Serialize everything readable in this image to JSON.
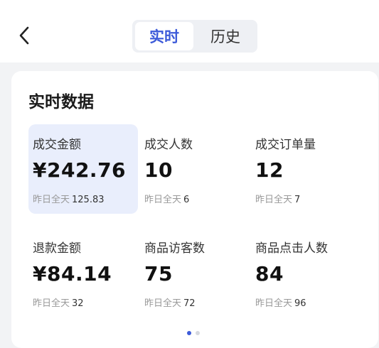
{
  "nav": {
    "back_icon": "chevron-left-icon",
    "tabs": [
      {
        "label": "实时",
        "active": true
      },
      {
        "label": "历史",
        "active": false
      }
    ]
  },
  "card": {
    "title": "实时数据",
    "metrics": [
      {
        "label": "成交金额",
        "value": "¥242.76",
        "sub_label": "昨日全天",
        "sub_value": "125.83",
        "highlighted": true
      },
      {
        "label": "成交人数",
        "value": "10",
        "sub_label": "昨日全天",
        "sub_value": "6",
        "highlighted": false
      },
      {
        "label": "成交订单量",
        "value": "12",
        "sub_label": "昨日全天",
        "sub_value": "7",
        "highlighted": false
      },
      {
        "label": "退款金额",
        "value": "¥84.14",
        "sub_label": "昨日全天",
        "sub_value": "32",
        "highlighted": false
      },
      {
        "label": "商品访客数",
        "value": "75",
        "sub_label": "昨日全天",
        "sub_value": "72",
        "highlighted": false
      },
      {
        "label": "商品点击人数",
        "value": "84",
        "sub_label": "昨日全天",
        "sub_value": "96",
        "highlighted": false
      }
    ]
  },
  "pager": {
    "current": 1,
    "total": 2
  },
  "colors": {
    "accent": "#3d5bd9",
    "highlight": "#e9eefc"
  }
}
